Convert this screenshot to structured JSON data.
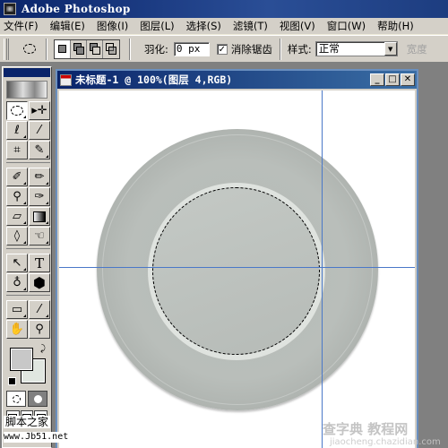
{
  "app": {
    "title": "Adobe Photoshop"
  },
  "menu": [
    {
      "label": "文件(F)"
    },
    {
      "label": "编辑(E)"
    },
    {
      "label": "图像(I)"
    },
    {
      "label": "图层(L)"
    },
    {
      "label": "选择(S)"
    },
    {
      "label": "滤镜(T)"
    },
    {
      "label": "视图(V)"
    },
    {
      "label": "窗口(W)"
    },
    {
      "label": "帮助(H)"
    }
  ],
  "options": {
    "tool_preset_icon": "elliptical-marquee-icon",
    "selection_modes": [
      {
        "name": "new-selection",
        "active": true
      },
      {
        "name": "add-to-selection",
        "active": false
      },
      {
        "name": "subtract-from-selection",
        "active": false
      },
      {
        "name": "intersect-with-selection",
        "active": false
      }
    ],
    "feather_label": "羽化:",
    "feather_value": "0 px",
    "antialias_checked": true,
    "antialias_check_glyph": "✓",
    "antialias_label": "消除锯齿",
    "style_label": "样式:",
    "style_value": "正常",
    "width_label": "宽度"
  },
  "toolbox": {
    "tools": [
      {
        "name": "elliptical-marquee",
        "glyph": "◌",
        "active": true
      },
      {
        "name": "move",
        "glyph": "▸✛",
        "active": false
      },
      {
        "name": "lasso",
        "glyph": "ℓ",
        "active": false
      },
      {
        "name": "magic-wand",
        "glyph": "⁄",
        "active": false
      },
      {
        "name": "crop",
        "glyph": "⌗",
        "active": false
      },
      {
        "name": "slice",
        "glyph": "✎",
        "active": false
      },
      {
        "name": "healing-brush",
        "glyph": "✐",
        "active": false
      },
      {
        "name": "brush",
        "glyph": "✏",
        "active": false
      },
      {
        "name": "clone-stamp",
        "glyph": "⚲",
        "active": false
      },
      {
        "name": "history-brush",
        "glyph": "✑",
        "active": false
      },
      {
        "name": "eraser",
        "glyph": "▱",
        "active": false
      },
      {
        "name": "gradient",
        "glyph": "▦",
        "active": false
      },
      {
        "name": "blur",
        "glyph": "◊",
        "active": false
      },
      {
        "name": "dodge",
        "glyph": "☜",
        "active": false
      },
      {
        "name": "path-selection",
        "glyph": "↖",
        "active": false
      },
      {
        "name": "type",
        "glyph": "T",
        "active": false
      },
      {
        "name": "pen",
        "glyph": "♁",
        "active": false
      },
      {
        "name": "custom-shape",
        "glyph": "⬢",
        "active": false
      },
      {
        "name": "notes",
        "glyph": "▭",
        "active": false
      },
      {
        "name": "eyedropper",
        "glyph": "⁄",
        "active": false
      },
      {
        "name": "hand",
        "glyph": "✋",
        "active": false
      },
      {
        "name": "zoom",
        "glyph": "⚲",
        "active": false
      }
    ],
    "foreground_color": "#c8c8c8",
    "background_color": "#e0e6e0",
    "swap_glyph": "⤸"
  },
  "document": {
    "title": "未标题-1 @ 100%(图层 4,RGB)",
    "minimize_glyph": "_",
    "maximize_glyph": "□",
    "close_glyph": "✕",
    "zoom_percent": 100,
    "layer": "图层 4",
    "color_mode": "RGB"
  },
  "watermarks": {
    "left_line1": "脚本之家",
    "left_line2": "www.Jb51.net",
    "right_line1": "查字典 教程网",
    "right_line2": "jiaocheng.chazidian.com"
  }
}
